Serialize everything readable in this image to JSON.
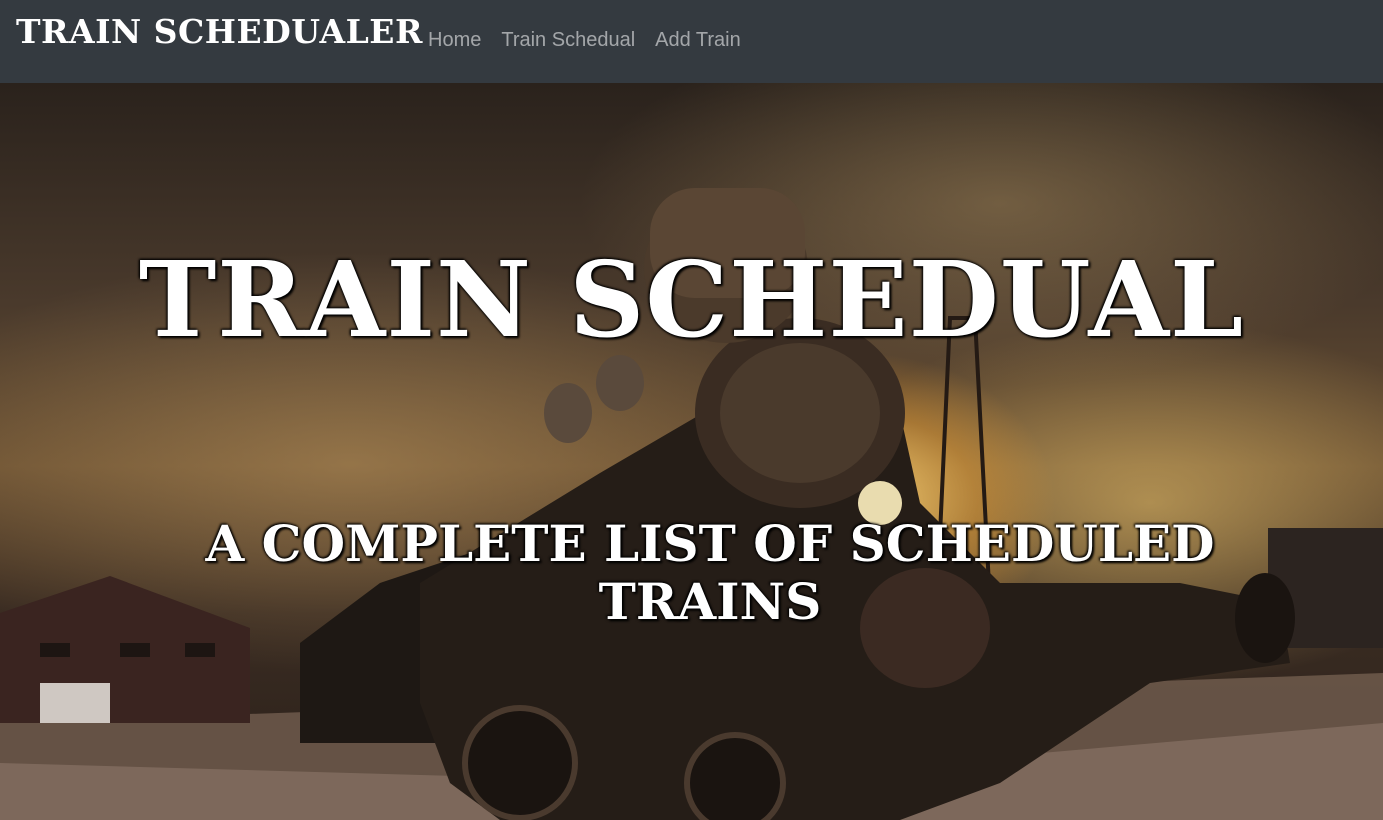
{
  "navbar": {
    "brand": "TRAIN SCHEDUALER",
    "links": [
      "Home",
      "Train Schedual",
      "Add Train"
    ]
  },
  "hero": {
    "title": "TRAIN SCHEDUAL",
    "subtitle": "A COMPLETE LIST OF SCHEDULED TRAINS"
  },
  "colors": {
    "navbar_bg": "#343a40",
    "brand_text": "#ffffff",
    "nav_link": "rgba(255,255,255,0.55)"
  }
}
